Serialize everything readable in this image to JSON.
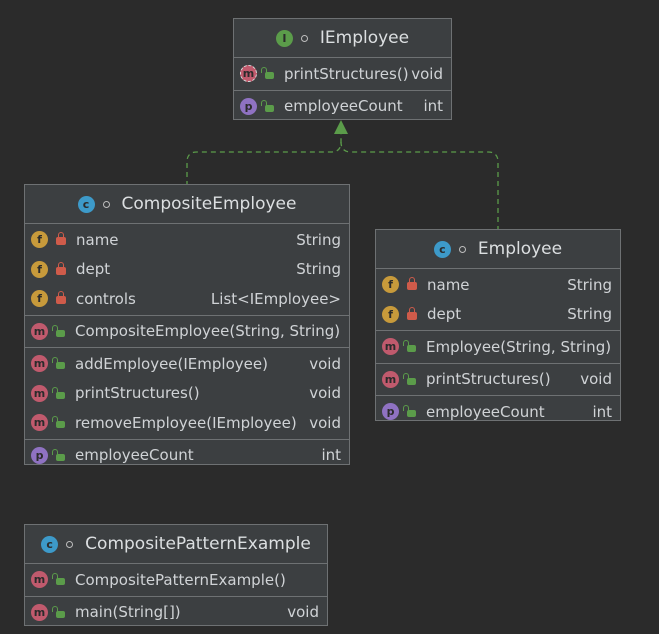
{
  "ie": {
    "name": "IEmployee",
    "badge": "I",
    "methods": [
      {
        "badge": "m",
        "name": "printStructures()",
        "type": "void"
      }
    ],
    "props": [
      {
        "badge": "p",
        "name": "employeeCount",
        "type": "int"
      }
    ]
  },
  "ce": {
    "name": "CompositeEmployee",
    "badge": "c",
    "fields": [
      {
        "badge": "f",
        "name": "name",
        "type": "String"
      },
      {
        "badge": "f",
        "name": "dept",
        "type": "String"
      },
      {
        "badge": "f",
        "name": "controls",
        "type": "List<IEmployee>"
      }
    ],
    "ctors": [
      {
        "badge": "m",
        "name": "CompositeEmployee(String, String)",
        "type": ""
      }
    ],
    "methods": [
      {
        "badge": "m",
        "name": "addEmployee(IEmployee)",
        "type": "void"
      },
      {
        "badge": "m",
        "name": "printStructures()",
        "type": "void"
      },
      {
        "badge": "m",
        "name": "removeEmployee(IEmployee)",
        "type": "void"
      }
    ],
    "props": [
      {
        "badge": "p",
        "name": "employeeCount",
        "type": "int"
      }
    ]
  },
  "emp": {
    "name": "Employee",
    "badge": "c",
    "fields": [
      {
        "badge": "f",
        "name": "name",
        "type": "String"
      },
      {
        "badge": "f",
        "name": "dept",
        "type": "String"
      }
    ],
    "ctors": [
      {
        "badge": "m",
        "name": "Employee(String, String)",
        "type": ""
      }
    ],
    "methods": [
      {
        "badge": "m",
        "name": "printStructures()",
        "type": "void"
      }
    ],
    "props": [
      {
        "badge": "p",
        "name": "employeeCount",
        "type": "int"
      }
    ]
  },
  "cpe": {
    "name": "CompositePatternExample",
    "badge": "c",
    "ctors": [
      {
        "badge": "m",
        "name": "CompositePatternExample()",
        "type": ""
      }
    ],
    "methods": [
      {
        "badge": "m",
        "name": "main(String[])",
        "type": "void"
      }
    ]
  },
  "colors": {
    "background": "#2b2b2b",
    "panel": "#3c3f41",
    "arrow": "#5b9c4a"
  }
}
